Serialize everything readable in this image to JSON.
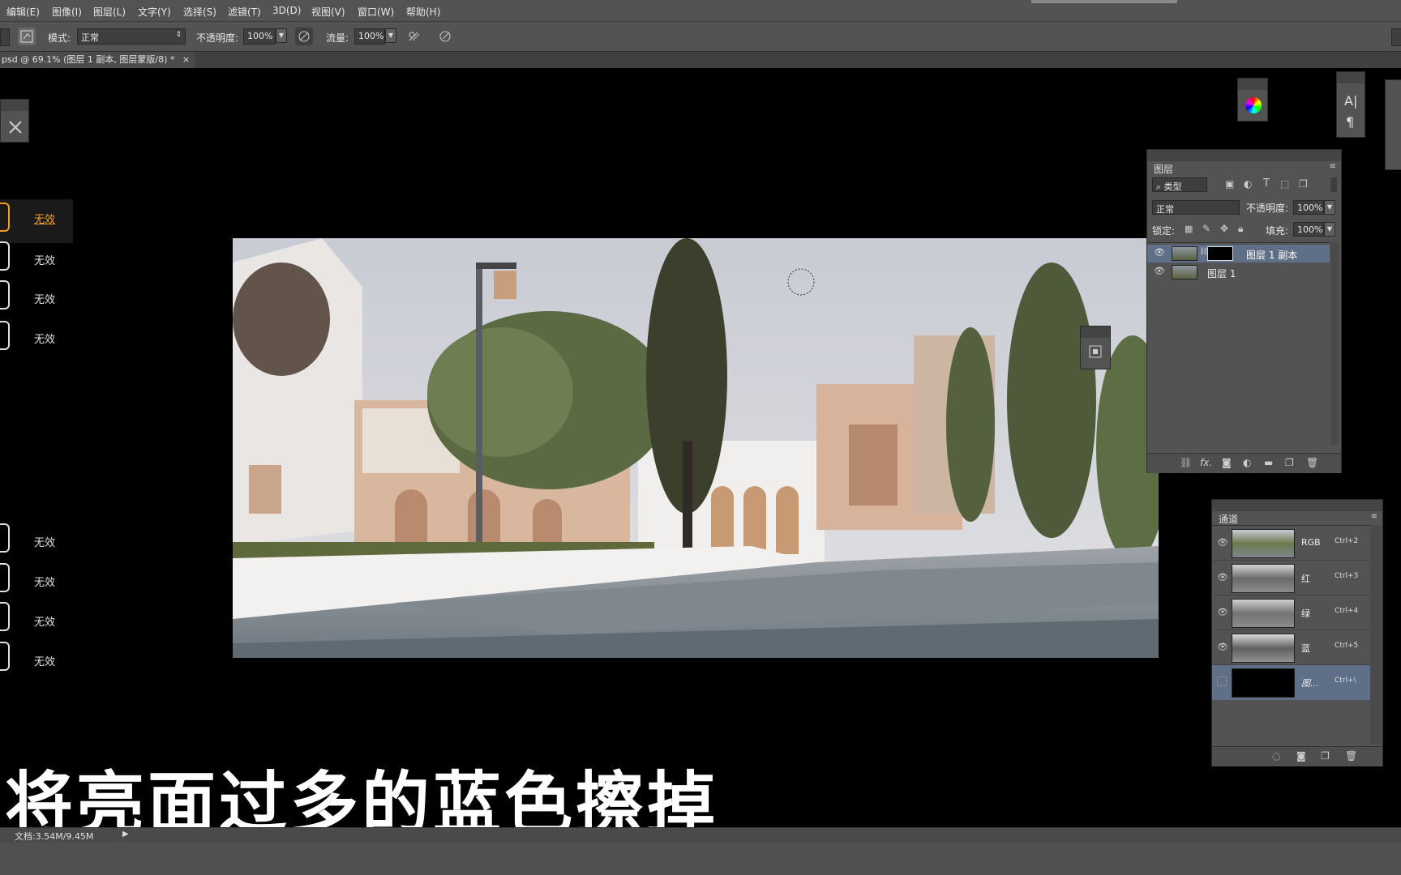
{
  "menu": [
    "编辑(E)",
    "图像(I)",
    "图层(L)",
    "文字(Y)",
    "选择(S)",
    "滤镜(T)",
    "3D(D)",
    "视图(V)",
    "窗口(W)",
    "帮助(H)"
  ],
  "options": {
    "mode_label": "模式:",
    "mode_value": "正常",
    "opacity_label": "不透明度:",
    "opacity_value": "100%",
    "flow_label": "流量:",
    "flow_value": "100%"
  },
  "doc_tab": "psd @ 69.1% (图层 1 副本, 图层蒙版/8) *",
  "doc_tab_close": "×",
  "left_panel": {
    "items": [
      "无效",
      "无效",
      "无效",
      "无效",
      "无效",
      "无效",
      "无效",
      "无效"
    ]
  },
  "layers_panel": {
    "title": "图层",
    "filter_kind": "类型",
    "blend_mode": "正常",
    "opacity_label": "不透明度:",
    "opacity_value": "100%",
    "lock_label": "锁定:",
    "fill_label": "填充:",
    "fill_value": "100%",
    "layers": [
      {
        "name": "图层 1 副本",
        "selected": true
      },
      {
        "name": "图层 1",
        "selected": false
      }
    ],
    "fx_label": "fx."
  },
  "channels_panel": {
    "title": "通道",
    "channels": [
      {
        "name": "RGB",
        "shortcut": "Ctrl+2"
      },
      {
        "name": "红",
        "shortcut": "Ctrl+3"
      },
      {
        "name": "绿",
        "shortcut": "Ctrl+4"
      },
      {
        "name": "蓝",
        "shortcut": "Ctrl+5"
      },
      {
        "name": "图...",
        "shortcut": "Ctrl+\\"
      }
    ]
  },
  "char_panel": {
    "char_icon": "A|",
    "para_icon": "¶"
  },
  "subtitle": "将亮面过多的蓝色擦掉",
  "status": {
    "doc_info": "文档:3.54M/9.45M",
    "arrow": "▶"
  },
  "colors": {
    "ui_bg": "#535353",
    "selected_layer": "#5e6f87",
    "accent_orange": "#f0a020"
  }
}
